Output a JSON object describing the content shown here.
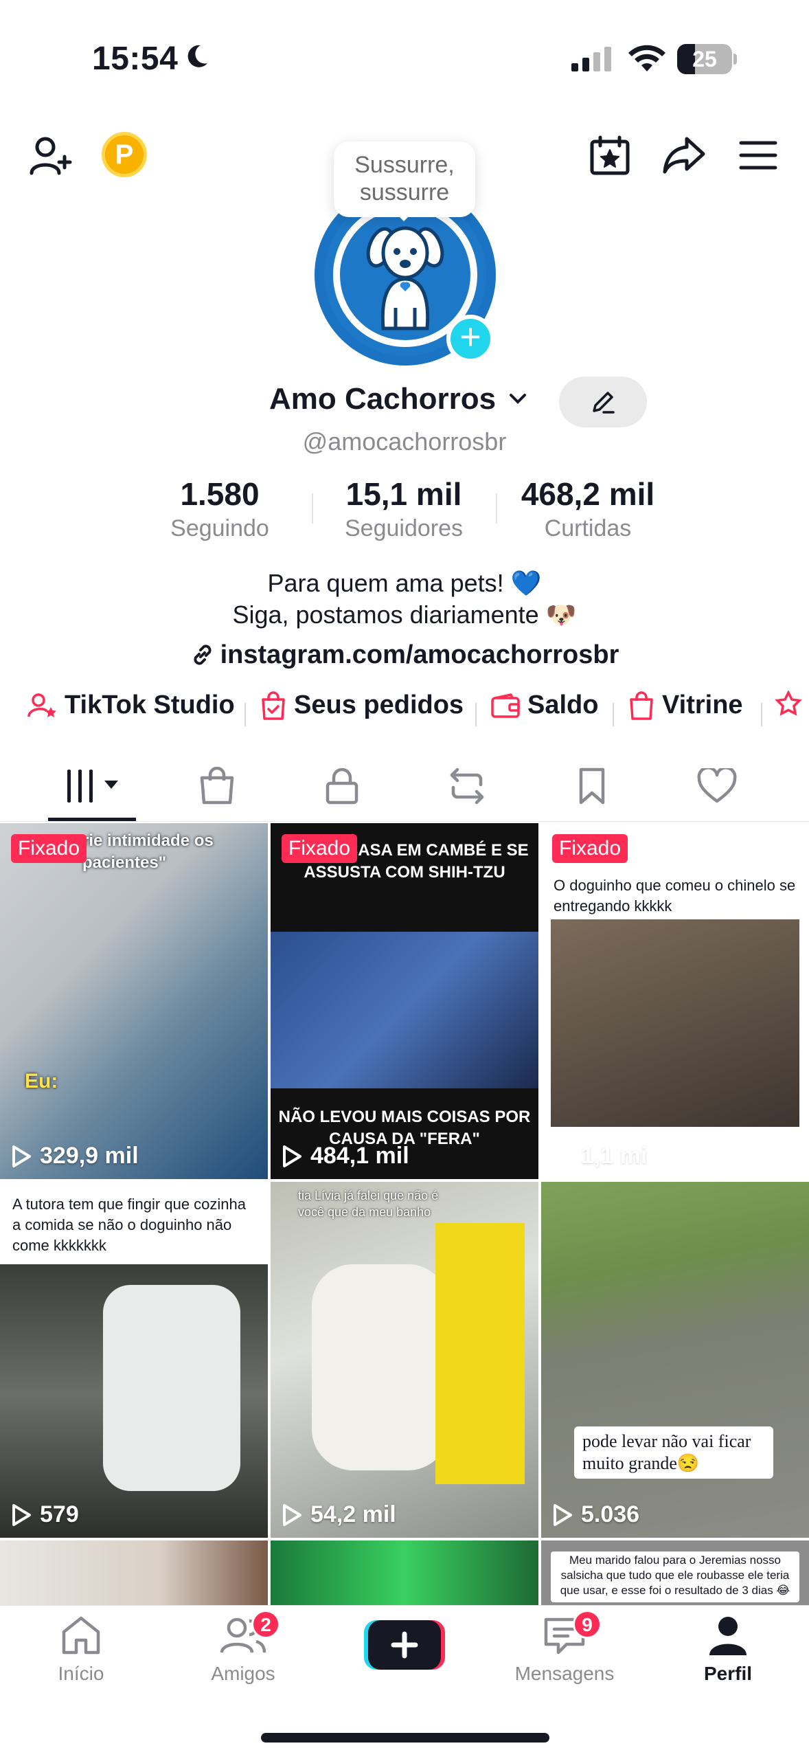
{
  "status_bar": {
    "time": "15:54",
    "battery": "25"
  },
  "header": {
    "coin_letter": "P"
  },
  "profile": {
    "bubble_text": "Sussurre, sussurre",
    "name": "Amo Cachorros",
    "handle": "@amocachorrosbr",
    "stats": [
      {
        "value": "1.580",
        "label": "Seguindo"
      },
      {
        "value": "15,1 mil",
        "label": "Seguidores"
      },
      {
        "value": "468,2 mil",
        "label": "Curtidas"
      }
    ],
    "bio_line1": "Para quem ama pets! 💙",
    "bio_line2": "Siga, postamos diariamente 🐶",
    "link": "instagram.com/amocachorrosbr"
  },
  "tools": [
    {
      "label": "TikTok Studio"
    },
    {
      "label": "Seus pedidos"
    },
    {
      "label": "Saldo"
    },
    {
      "label": "Vitrine"
    }
  ],
  "videos": [
    {
      "pinned_label": "Fixado",
      "views": "329,9 mil",
      "caption_top": "rie intimidade  os pacientes\"",
      "caption_bottom": "Eu:"
    },
    {
      "pinned_label": "Fixado",
      "views": "484,1 mil",
      "caption_top": "INVADE CASA EM CAMBÉ E SE ASSUSTA COM SHIH-TZU",
      "caption_bottom": "NÃO LEVOU MAIS COISAS POR CAUSA DA \"FERA\""
    },
    {
      "pinned_label": "Fixado",
      "views": "1,1 mi",
      "caption_top": "O doguinho que comeu o chinelo se entregando kkkkk"
    },
    {
      "views": "579",
      "caption_top": "A tutora tem que fingir que cozinha a comida se não o doguinho não come kkkkkkk"
    },
    {
      "views": "54,2 mil",
      "caption_top": "tia Lívia já falei que não é você que da meu banho"
    },
    {
      "views": "5.036",
      "caption_top": "pode levar não vai ficar muito grande😒"
    },
    {
      "caption_top": ""
    },
    {
      "caption_top": ""
    },
    {
      "caption_top": "Meu marido falou para o Jeremias nosso salsicha que tudo que ele roubasse ele teria que usar, e esse foi o resultado de 3 dias 😂"
    }
  ],
  "nav": {
    "home": "Início",
    "friends": "Amigos",
    "friends_badge": "2",
    "messages": "Mensagens",
    "messages_badge": "9",
    "profile": "Perfil"
  },
  "colors": {
    "accent": "#fe2c55",
    "cyan": "#20d5ec",
    "avatar_blue": "#1b73c3"
  }
}
